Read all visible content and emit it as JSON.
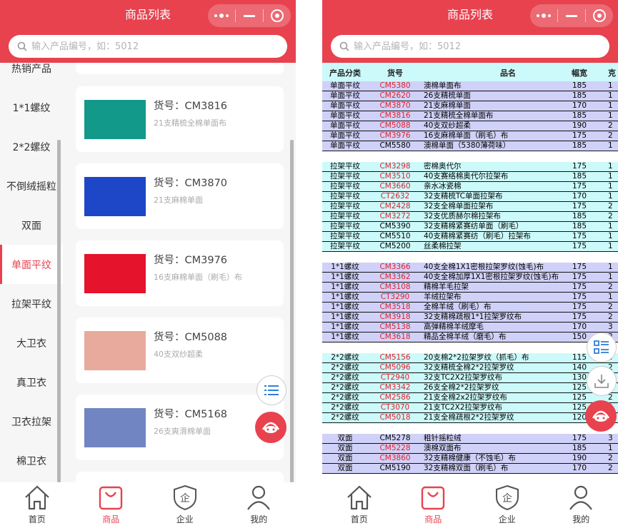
{
  "app": {
    "title": "商品列表",
    "search_placeholder": "输入产品编号，如：5012",
    "accent": "#e8424f"
  },
  "categories": [
    {
      "label": "热销产品",
      "active": false
    },
    {
      "label": "1*1螺纹",
      "active": false
    },
    {
      "label": "2*2螺纹",
      "active": false
    },
    {
      "label": "不倒绒摇粒",
      "active": false
    },
    {
      "label": "双面",
      "active": false
    },
    {
      "label": "单面平纹",
      "active": true
    },
    {
      "label": "拉架平纹",
      "active": false
    },
    {
      "label": "大卫衣",
      "active": false
    },
    {
      "label": "真卫衣",
      "active": false
    },
    {
      "label": "卫衣拉架",
      "active": false
    },
    {
      "label": "棉卫衣",
      "active": false
    }
  ],
  "products": [
    {
      "code": "货号：CM3816",
      "desc": "21支精梳全棉单面布",
      "color": "#12998a"
    },
    {
      "code": "货号：CM3870",
      "desc": "21支麻棉单面",
      "color": "#1d47c6"
    },
    {
      "code": "货号：CM3976",
      "desc": "16支麻棉单面（刷毛）布",
      "color": "#e5132b"
    },
    {
      "code": "货号：CM5088",
      "desc": "40支双纱超柔",
      "color": "#e8aa9c"
    },
    {
      "code": "货号：CM5168",
      "desc": "26支爽滑棉单面",
      "color": "#7185c2"
    }
  ],
  "tabs": [
    {
      "label": "首页",
      "icon": "home-icon",
      "active": false
    },
    {
      "label": "商品",
      "icon": "shopping-bag-icon",
      "active": true
    },
    {
      "label": "企业",
      "icon": "company-shield-icon",
      "active": false
    },
    {
      "label": "我的",
      "icon": "user-icon",
      "active": false
    }
  ],
  "table": {
    "headers": [
      "产品分类",
      "货号",
      "品名",
      "幅宽",
      "克"
    ],
    "groups": [
      {
        "bg": "#d0d1f8",
        "rows": [
          [
            "单面平纹",
            "CM5380",
            "澳棉单面布",
            "185",
            "1",
            true
          ],
          [
            "单面平纹",
            "CM2620",
            "26支精梳单面",
            "185",
            "1",
            true
          ],
          [
            "单面平纹",
            "CM3870",
            "21支麻棉单面",
            "170",
            "1",
            true
          ],
          [
            "单面平纹",
            "CM3816",
            "21支精梳全棉单面布",
            "185",
            "1",
            true
          ],
          [
            "单面平纹",
            "CM5088",
            "40支双纱超柔",
            "190",
            "2",
            true
          ],
          [
            "单面平纹",
            "CM3976",
            "16支麻棉单面（刷毛）布",
            "175",
            "2",
            true
          ],
          [
            "单面平纹",
            "CM5580",
            "澳棉单面（5380薄荷味）",
            "185",
            "1",
            false
          ]
        ]
      },
      {
        "bg": "#ccfafa",
        "rows": [
          [
            "拉架平纹",
            "CM3298",
            "密棉奥代尔",
            "175",
            "1",
            true
          ],
          [
            "拉架平纹",
            "CM3510",
            "40支赛络棉奥代尔拉架布",
            "185",
            "1",
            true
          ],
          [
            "拉架平纹",
            "CM3660",
            "亲水冰瓷棉",
            "175",
            "1",
            true
          ],
          [
            "拉架平纹",
            "CT2632",
            "32支精梳TC单面拉架布",
            "170",
            "1",
            true
          ],
          [
            "拉架平纹",
            "CM2428",
            "32支全棉单面拉架布",
            "175",
            "2",
            true
          ],
          [
            "拉架平纹",
            "CM3272",
            "32支优质赫尔棉拉架布",
            "185",
            "2",
            true
          ],
          [
            "拉架平纹",
            "CM5390",
            "32支精棉紧赛纺单面（刷毛）",
            "185",
            "1",
            false
          ],
          [
            "拉架平纹",
            "CM5510",
            "40支精棉紧赛纺（刷毛）拉架布",
            "175",
            "1",
            false
          ],
          [
            "拉架平纹",
            "CM5200",
            "丝柔棉拉架",
            "175",
            "1",
            false
          ]
        ]
      },
      {
        "bg": "#d0d1f8",
        "rows": [
          [
            "1*1螺纹",
            "CM3366",
            "40支全棉1X1密根拉架罗纹(蚀毛)布",
            "175",
            "1",
            true
          ],
          [
            "1*1螺纹",
            "CM3362",
            "40支全棉加厚1X1密根拉架罗纹(蚀毛)布",
            "175",
            "1",
            true
          ],
          [
            "1*1螺纹",
            "CM3108",
            "精棉羊毛拉架",
            "175",
            "2",
            true
          ],
          [
            "1*1螺纹",
            "CT3290",
            "羊绒拉架布",
            "175",
            "1",
            true
          ],
          [
            "1*1螺纹",
            "CM3518",
            "全棉羊绒（刷毛）布",
            "175",
            "2",
            true
          ],
          [
            "1*1螺纹",
            "CM3918",
            "32支精棉疏根1*1拉架罗纹布",
            "175",
            "2",
            true
          ],
          [
            "1*1螺纹",
            "CM5138",
            "高弹精棉羊绒摩毛",
            "170",
            "3",
            true
          ],
          [
            "1*1螺纹",
            "CM3618",
            "精品全棉羊绒（磨毛）布",
            "150",
            "3",
            true
          ]
        ]
      },
      {
        "bg": "#ccfafa",
        "rows": [
          [
            "2*2螺纹",
            "CM5156",
            "20支棉2*2拉架罗纹（抓毛）布",
            "115",
            "4",
            true
          ],
          [
            "2*2螺纹",
            "CM5096",
            "32支精梳全棉2*2拉架罗纹",
            "140",
            "2",
            true
          ],
          [
            "2*2螺纹",
            "CT2940",
            "32支TC2X2拉架罗纹布",
            "130",
            "2",
            true
          ],
          [
            "2*2螺纹",
            "CM3342",
            "26支全棉2*2拉架罗纹",
            "125",
            "2",
            true
          ],
          [
            "2*2螺纹",
            "CM2586",
            "21支全棉2x2拉架罗纹布",
            "125",
            "2",
            true
          ],
          [
            "2*2螺纹",
            "CT3070",
            "21支TC2X2拉架罗纹布",
            "125",
            "2",
            true
          ],
          [
            "2*2螺纹",
            "CM5018",
            "21支全棉疏根2*2拉架罗纹",
            "120",
            "2",
            true
          ]
        ]
      },
      {
        "bg": "#d0d1f8",
        "rows": [
          [
            "双面",
            "CM5278",
            "粗针摇粒绒",
            "175",
            "3",
            false
          ],
          [
            "双面",
            "CM5228",
            "澳棉双面布",
            "185",
            "1",
            true
          ],
          [
            "双面",
            "CM3860",
            "32支精棉健康（不蚀毛）布",
            "190",
            "2",
            true
          ],
          [
            "双面",
            "CM5190",
            "32支精棉双面（刷毛）布",
            "170",
            "2",
            false
          ]
        ]
      }
    ]
  }
}
